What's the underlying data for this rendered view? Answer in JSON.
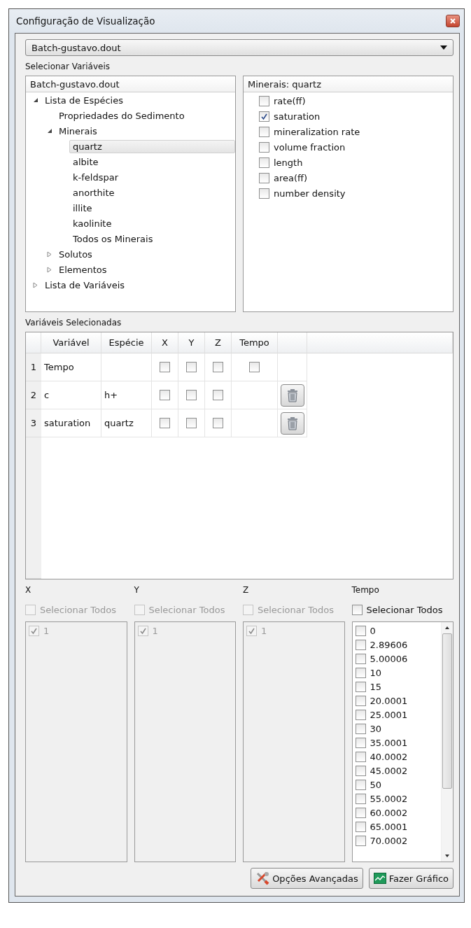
{
  "window": {
    "title": "Configuração de Visualização"
  },
  "file_select": {
    "value": "Batch-gustavo.dout"
  },
  "select_variables": {
    "label": "Selecionar Variáveis",
    "tree": {
      "header": "Batch-gustavo.dout",
      "items": [
        {
          "label": "Lista de Espécies",
          "expanded": true,
          "selected": false,
          "children": [
            {
              "label": "Propriedades do Sedimento",
              "selected": false
            },
            {
              "label": "Minerais",
              "expanded": true,
              "selected": false,
              "children": [
                {
                  "label": "quartz",
                  "selected": true
                },
                {
                  "label": "albite",
                  "selected": false
                },
                {
                  "label": "k-feldspar",
                  "selected": false
                },
                {
                  "label": "anorthite",
                  "selected": false
                },
                {
                  "label": "illite",
                  "selected": false
                },
                {
                  "label": "kaolinite",
                  "selected": false
                },
                {
                  "label": "Todos os Minerais",
                  "selected": false
                }
              ]
            },
            {
              "label": "Solutos",
              "expanded": false,
              "selected": false
            },
            {
              "label": "Elementos",
              "expanded": false,
              "selected": false
            }
          ]
        },
        {
          "label": "Lista de Variáveis",
          "expanded": false,
          "selected": false
        }
      ]
    },
    "properties": {
      "header": "Minerais: quartz",
      "items": [
        {
          "label": "rate(ff)",
          "checked": false
        },
        {
          "label": "saturation",
          "checked": true
        },
        {
          "label": "mineralization rate",
          "checked": false
        },
        {
          "label": "volume fraction",
          "checked": false
        },
        {
          "label": "length",
          "checked": false
        },
        {
          "label": "area(ff)",
          "checked": false
        },
        {
          "label": "number density",
          "checked": false
        }
      ]
    }
  },
  "selected_variables": {
    "label": "Variáveis Selecionadas",
    "columns": [
      "Variável",
      "Espécie",
      "X",
      "Y",
      "Z",
      "Tempo"
    ],
    "rows": [
      {
        "number": "1",
        "variable": "Tempo",
        "species": "",
        "x": false,
        "y": false,
        "z": false,
        "tempo": false,
        "deletable": false
      },
      {
        "number": "2",
        "variable": "c",
        "species": "h+",
        "x": false,
        "y": false,
        "z": false,
        "deletable": true
      },
      {
        "number": "3",
        "variable": "saturation",
        "species": "quartz",
        "x": false,
        "y": false,
        "z": false,
        "deletable": true
      }
    ]
  },
  "axes": [
    {
      "label": "X",
      "select_all": {
        "label": "Selecionar Todos",
        "checked": false,
        "disabled": true
      },
      "items": [
        {
          "label": "1",
          "checked": true,
          "disabled": true
        }
      ]
    },
    {
      "label": "Y",
      "select_all": {
        "label": "Selecionar Todos",
        "checked": false,
        "disabled": true
      },
      "items": [
        {
          "label": "1",
          "checked": true,
          "disabled": true
        }
      ]
    },
    {
      "label": "Z",
      "select_all": {
        "label": "Selecionar Todos",
        "checked": false,
        "disabled": true
      },
      "items": [
        {
          "label": "1",
          "checked": true,
          "disabled": true
        }
      ]
    },
    {
      "label": "Tempo",
      "select_all": {
        "label": "Selecionar Todos",
        "checked": false,
        "disabled": false
      },
      "scrollable": true,
      "items": [
        {
          "label": "0",
          "checked": false,
          "disabled": false
        },
        {
          "label": "2.89606",
          "checked": false,
          "disabled": false
        },
        {
          "label": "5.00006",
          "checked": false,
          "disabled": false
        },
        {
          "label": "10",
          "checked": false,
          "disabled": false
        },
        {
          "label": "15",
          "checked": false,
          "disabled": false
        },
        {
          "label": "20.0001",
          "checked": false,
          "disabled": false
        },
        {
          "label": "25.0001",
          "checked": false,
          "disabled": false
        },
        {
          "label": "30",
          "checked": false,
          "disabled": false
        },
        {
          "label": "35.0001",
          "checked": false,
          "disabled": false
        },
        {
          "label": "40.0002",
          "checked": false,
          "disabled": false
        },
        {
          "label": "45.0002",
          "checked": false,
          "disabled": false
        },
        {
          "label": "50",
          "checked": false,
          "disabled": false
        },
        {
          "label": "55.0002",
          "checked": false,
          "disabled": false
        },
        {
          "label": "60.0002",
          "checked": false,
          "disabled": false
        },
        {
          "label": "65.0001",
          "checked": false,
          "disabled": false
        },
        {
          "label": "70.0002",
          "checked": false,
          "disabled": false
        }
      ]
    }
  ],
  "buttons": [
    {
      "kind": "tools",
      "label": "Opções Avançadas"
    },
    {
      "kind": "chart",
      "label": "Fazer Gráfico"
    }
  ]
}
